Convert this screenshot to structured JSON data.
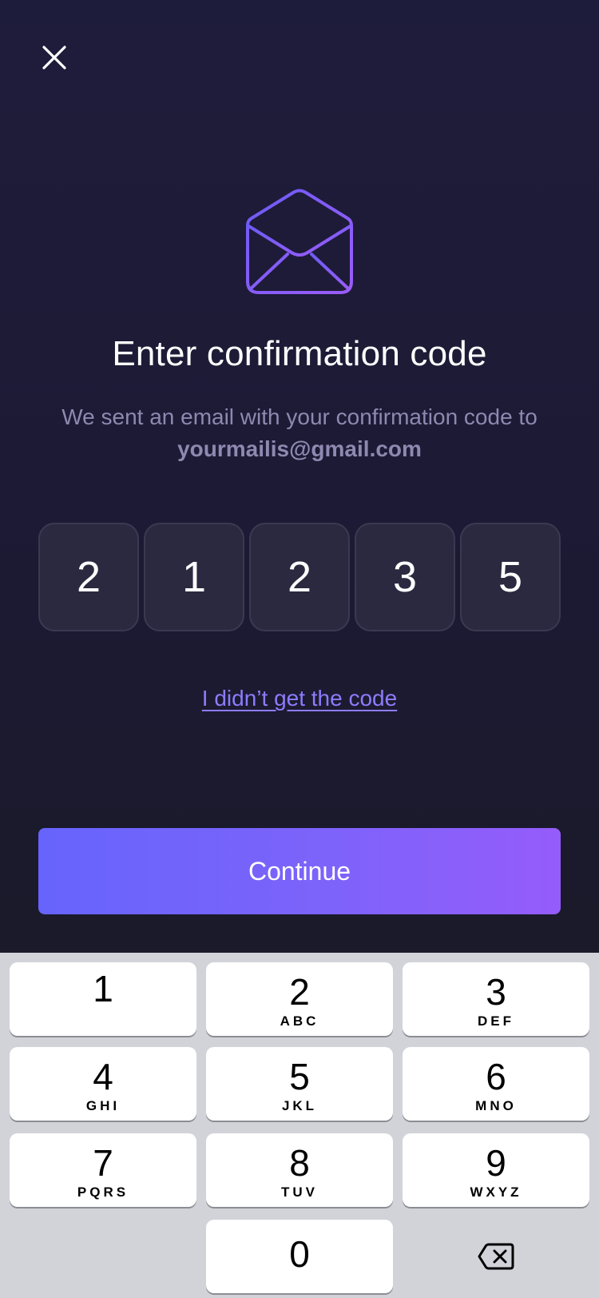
{
  "header": {
    "close_icon": "close-icon"
  },
  "hero": {
    "icon": "envelope-open-icon",
    "icon_gradient": [
      "#6d5bf6",
      "#9b5cf9"
    ],
    "title": "Enter confirmation code",
    "subtitle": "We sent an email with your confirmation code to",
    "email": "yourmailis@gmail.com"
  },
  "code": {
    "digits": [
      "2",
      "1",
      "2",
      "3",
      "5"
    ]
  },
  "resend_link": "I didn’t get the code",
  "continue_label": "Continue",
  "colors": {
    "accent": "#7b68fb",
    "background": "#1e1c3b",
    "link": "#8c7cff",
    "keyboard": "#d1d3d9"
  },
  "keypad": {
    "keys": [
      {
        "num": "1",
        "letters": ""
      },
      {
        "num": "2",
        "letters": "ABC"
      },
      {
        "num": "3",
        "letters": "DEF"
      },
      {
        "num": "4",
        "letters": "GHI"
      },
      {
        "num": "5",
        "letters": "JKL"
      },
      {
        "num": "6",
        "letters": "MNO"
      },
      {
        "num": "7",
        "letters": "PQRS"
      },
      {
        "num": "8",
        "letters": "TUV"
      },
      {
        "num": "9",
        "letters": "WXYZ"
      },
      {
        "num": "0",
        "letters": ""
      }
    ],
    "backspace_icon": "backspace-icon"
  }
}
